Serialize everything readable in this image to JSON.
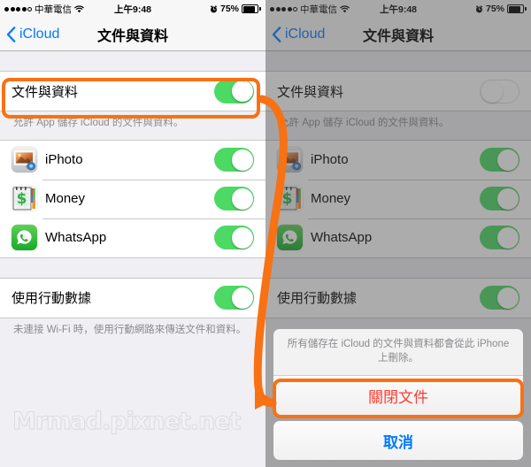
{
  "status_bar": {
    "signal_dots_filled": 4,
    "signal_dots_total": 5,
    "carrier": "中華電信",
    "wifi_icon": "wifi-icon",
    "time": "上午9:48",
    "alarm_icon": "alarm-icon",
    "battery_percent": "75%",
    "battery_icon": "battery-icon"
  },
  "nav": {
    "back_label": "iCloud",
    "back_icon": "chevron-left-icon",
    "title": "文件與資料"
  },
  "documents_section": {
    "row_label": "文件與資料",
    "toggle_left_state": "on",
    "toggle_right_state": "off",
    "footnote": "允許 App 儲存 iCloud 的文件與資料。"
  },
  "apps": [
    {
      "name": "iPhoto",
      "icon": "iphoto-icon",
      "toggle": "on"
    },
    {
      "name": "Money",
      "icon": "money-icon",
      "toggle": "on"
    },
    {
      "name": "WhatsApp",
      "icon": "whatsapp-icon",
      "toggle": "on"
    }
  ],
  "cellular_section": {
    "row_label": "使用行動數據",
    "toggle": "on",
    "footnote": "未連接 Wi-Fi 時，使用行動網路來傳送文件和資料。"
  },
  "watermark": "Mrmad.pixnet.net",
  "action_sheet": {
    "message": "所有儲存在 iCloud 的文件與資料都會從此 iPhone 上刪除。",
    "destructive_label": "關閉文件",
    "cancel_label": "取消"
  },
  "annotation": {
    "highlight_color": "#f87113",
    "arrow_icon": "curved-arrow-icon"
  }
}
